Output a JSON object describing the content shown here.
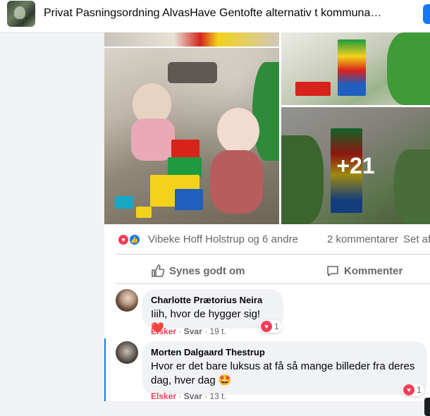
{
  "header": {
    "group_title": "Privat Pasningsordning AlvasHave Gentofte alternativ t kommuna…"
  },
  "post": {
    "photos_more_count": "+21",
    "reactions": {
      "icons": [
        "love-icon",
        "like-icon"
      ],
      "names": "Vibeke Hoff Holstrup og 6 andre",
      "comments": "2 kommentarer",
      "shares": "Set af"
    },
    "actions": {
      "like_label": "Synes godt om",
      "comment_label": "Kommenter"
    },
    "comments": [
      {
        "author": "Charlotte Prætorius Neira",
        "text": "Iiih, hvor de hygger sig!",
        "emoji": "❤️",
        "love_label": "Elsker",
        "sep": "·",
        "reply_label": "Svar",
        "time": "19 t.",
        "reaction_count": "1"
      },
      {
        "author": "Morten Dalgaard Thestrup",
        "text": "Hvor er det bare luksus at få så mange billeder fra deres dag, hver dag",
        "emoji": "🤩",
        "love_label": "Elsker",
        "sep": "·",
        "reply_label": "Svar",
        "time": "13 t.",
        "reaction_count": "1"
      }
    ]
  },
  "colors": {
    "accent": "#1877f2",
    "love": "#f33e58",
    "secondary_text": "#65676b",
    "bubble": "#f0f2f5"
  }
}
